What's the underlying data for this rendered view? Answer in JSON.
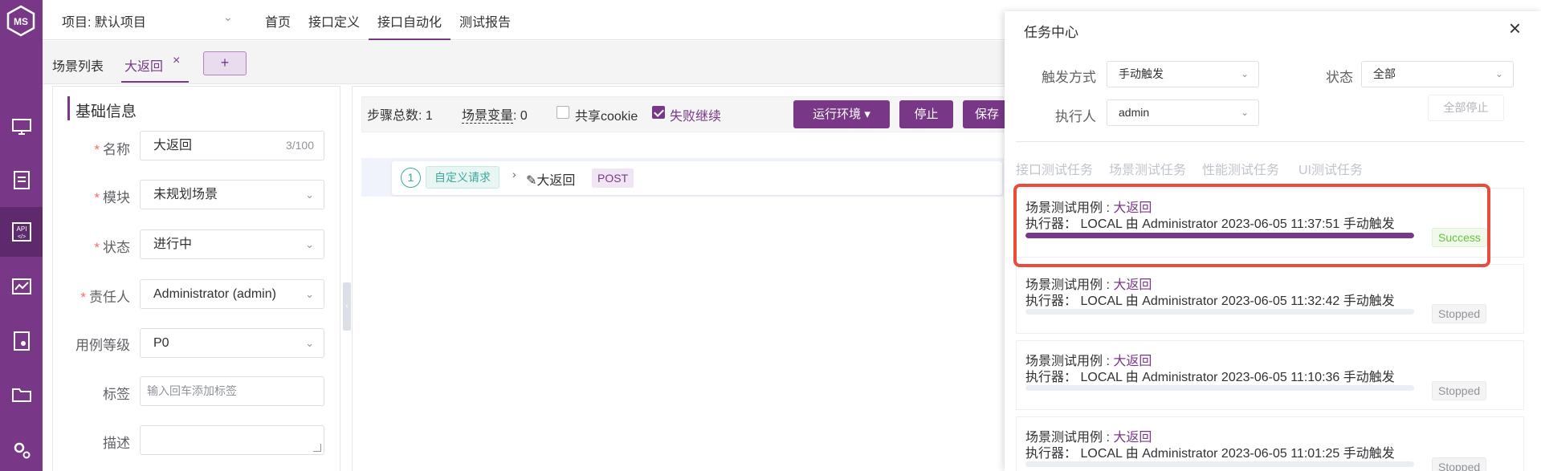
{
  "topbar": {
    "project": "项目: 默认项目",
    "nav": [
      "首页",
      "接口定义",
      "接口自动化",
      "测试报告"
    ]
  },
  "tabs": {
    "list_label": "场景列表",
    "active_tab": "大返回",
    "close": "×",
    "add": "+"
  },
  "form": {
    "section_title": "基础信息",
    "fields": {
      "name": {
        "label": "名称",
        "value": "大返回",
        "counter": "3/100"
      },
      "module": {
        "label": "模块",
        "value": "未规划场景"
      },
      "status": {
        "label": "状态",
        "value": "进行中"
      },
      "owner": {
        "label": "责任人",
        "value": "Administrator (admin)"
      },
      "level": {
        "label": "用例等级",
        "value": "P0"
      },
      "tags": {
        "label": "标签",
        "placeholder": "输入回车添加标签"
      },
      "desc": {
        "label": "描述"
      }
    },
    "required_mark": "*"
  },
  "steps": {
    "total_label": "步骤总数:",
    "total_value": "1",
    "vars_label": "场景变量",
    "vars_value": ": 0",
    "share_cookie": "共享cookie",
    "continue_on_fail": "失败继续",
    "run_env": "运行环境",
    "stop": "停止",
    "save": "保存",
    "step": {
      "index": "1",
      "type": "自定义请求",
      "name": "大返回",
      "method": "POST"
    }
  },
  "task_center": {
    "title": "任务中心",
    "close": "×",
    "filters": {
      "trigger_label": "触发方式",
      "trigger_value": "手动触发",
      "status_label": "状态",
      "status_value": "全部",
      "executor_label": "执行人",
      "executor_value": "admin",
      "stop_all": "全部停止"
    },
    "tabs": [
      "接口测试任务",
      "场景测试任务",
      "性能测试任务",
      "UI测试任务"
    ],
    "tasks": [
      {
        "type": "场景测试用例 :",
        "name": "大返回",
        "executor_prefix": "执行器：",
        "detail": "LOCAL 由 Administrator 2023-06-05 11:37:51 手动触发",
        "status": "Success",
        "progress": 100
      },
      {
        "type": "场景测试用例 :",
        "name": "大返回",
        "executor_prefix": "执行器：",
        "detail": "LOCAL 由 Administrator 2023-06-05 11:32:42 手动触发",
        "status": "Stopped",
        "progress": 0
      },
      {
        "type": "场景测试用例 :",
        "name": "大返回",
        "executor_prefix": "执行器：",
        "detail": "LOCAL 由 Administrator 2023-06-05 11:10:36 手动触发",
        "status": "Stopped",
        "progress": 0
      },
      {
        "type": "场景测试用例 :",
        "name": "大返回",
        "executor_prefix": "执行器：",
        "detail": "LOCAL 由 Administrator 2023-06-05 11:01:25 手动触发",
        "status": "Stopped",
        "progress": 0
      }
    ]
  },
  "colors": {
    "brand": "#783887",
    "success": "#67c23a",
    "highlight": "#e74c3c"
  },
  "icons": [
    "logo-icon",
    "monitor-icon",
    "clipboard-icon",
    "api-icon",
    "performance-icon",
    "report-icon",
    "folder-icon",
    "settings-icon"
  ]
}
